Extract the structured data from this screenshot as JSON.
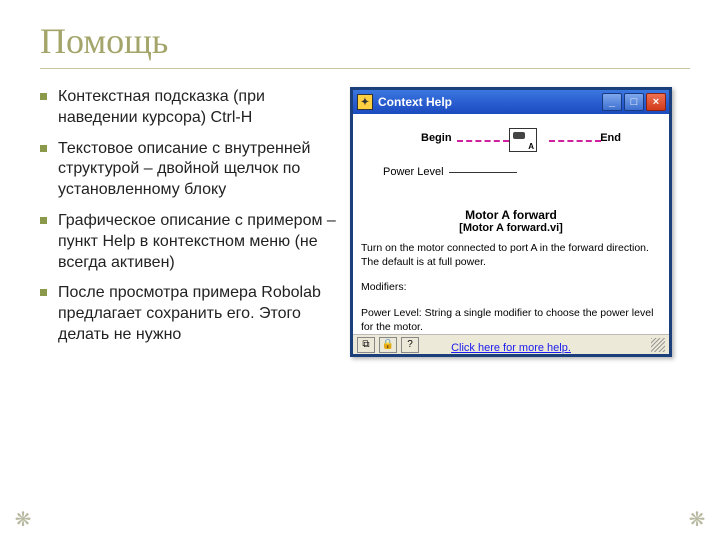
{
  "title": "Помощь",
  "bullets": [
    "Контекстная подсказка (при наведении курсора) Ctrl-H",
    "Текстовое описание с внутренней структурой – двойной щелчок по установленному блоку",
    "Графическое описание с примером – пункт Help в контекстном меню (не всегда активен)",
    "После просмотра примера Robolab предлагает сохранить его. Этого делать не нужно"
  ],
  "window": {
    "title": "Context Help",
    "diagram": {
      "begin": "Begin",
      "end": "End",
      "power": "Power Level"
    },
    "vi_title": "Motor A forward",
    "vi_file": "[Motor A forward.vi]",
    "description": "Turn on the motor connected to port A in the forward direction.  The default is at full power.",
    "modifiers_label": "Modifiers:",
    "modifier_text": "Power Level:  String a single modifier to choose the power level for the motor.",
    "help_link": "Click here for more help.",
    "status": {
      "b1": "⧉",
      "b2": "🔒",
      "b3": "?"
    }
  },
  "nav": {
    "left": "❋",
    "right": "❋"
  }
}
